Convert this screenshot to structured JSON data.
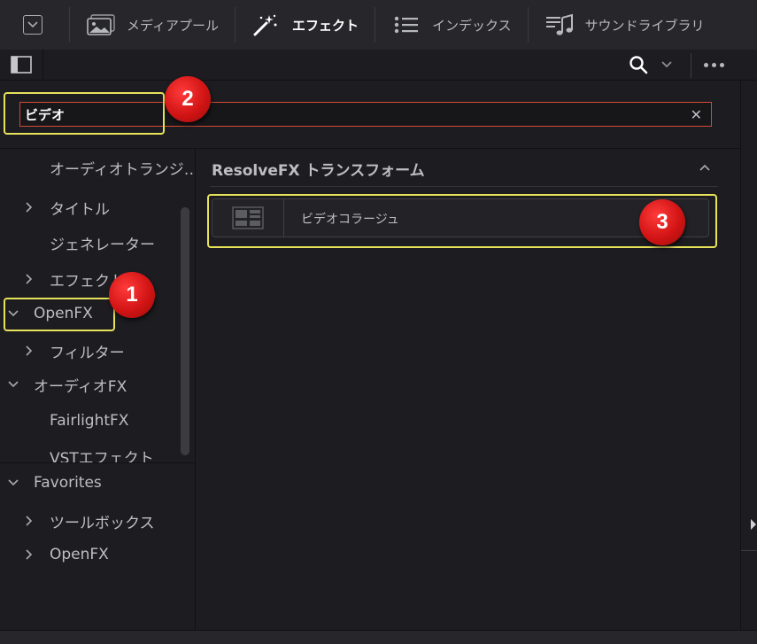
{
  "topbar": {
    "tabs": [
      {
        "label": "メディアプール",
        "icon": "image-icon"
      },
      {
        "label": "エフェクト",
        "icon": "magic-wand-icon",
        "active": true
      },
      {
        "label": "インデックス",
        "icon": "list-icon"
      },
      {
        "label": "サウンドライブラリ",
        "icon": "music-note-icon"
      }
    ]
  },
  "search": {
    "value": "ビデオ",
    "clear": "✕"
  },
  "sidebar": {
    "items": [
      {
        "label": "オーディオトランジ…"
      },
      {
        "label": "タイトル"
      },
      {
        "label": "ジェネレーター"
      },
      {
        "label": "エフェクト"
      },
      {
        "label": "OpenFX"
      },
      {
        "label": "フィルター"
      },
      {
        "label": "オーディオFX"
      },
      {
        "label": "FairlightFX"
      },
      {
        "label": "VSTエフェクト"
      }
    ],
    "favorites": {
      "label": "Favorites",
      "items": [
        {
          "label": "ツールボックス"
        },
        {
          "label": "OpenFX"
        }
      ]
    }
  },
  "content": {
    "section_title": "ResolveFX トランスフォーム",
    "effects": [
      {
        "label": "ビデオコラージュ"
      }
    ]
  },
  "annotations": {
    "badges": [
      "1",
      "2",
      "3"
    ]
  },
  "colors": {
    "highlight": "#e7e25a",
    "badge": "#d21414",
    "search_border": "#d24a36"
  }
}
